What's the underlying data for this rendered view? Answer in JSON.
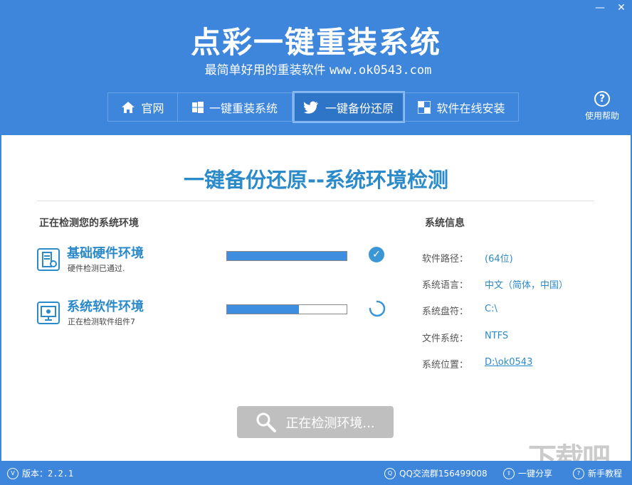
{
  "window": {
    "minimize": "—",
    "close": "✕"
  },
  "header": {
    "title": "点彩一键重装系统",
    "subtitle_text": "最简单好用的重装软件",
    "subtitle_url": "www.ok0543.com",
    "help_label": "使用帮助"
  },
  "nav": {
    "tabs": [
      {
        "label": "官网",
        "icon": "home-icon"
      },
      {
        "label": "一键重装系统",
        "icon": "windows-icon"
      },
      {
        "label": "一键备份还原",
        "icon": "bird-icon",
        "active": true
      },
      {
        "label": "软件在线安装",
        "icon": "grid-icon"
      }
    ]
  },
  "main": {
    "title": "一键备份还原--系统环境检测",
    "left_section": "正在检测您的系统环境",
    "right_section": "系统信息",
    "checks": [
      {
        "name": "基础硬件环境",
        "desc": "硬件检测已通过.",
        "progress": 1.0,
        "status": "done"
      },
      {
        "name": "系统软件环境",
        "desc": "正在检测软件组件7",
        "progress": 0.6,
        "status": "running"
      }
    ],
    "info": [
      {
        "key": "软件路径：",
        "value": "(64位)"
      },
      {
        "key": "系统语言：",
        "value": "中文（简体，中国）"
      },
      {
        "key": "系统盘符：",
        "value": "C:\\"
      },
      {
        "key": "文件系统：",
        "value": "NTFS"
      },
      {
        "key": "系统位置：",
        "value": "D:\\ok0543"
      }
    ],
    "button_label": "正在检测环境..."
  },
  "footer": {
    "version": "版本：2.2.1",
    "qq": "QQ交流群156499008",
    "share": "一键分享",
    "tutorial": "新手教程"
  },
  "watermark": "下载吧",
  "colors": {
    "primary": "#3d86dc",
    "accent": "#2b8ac9",
    "button_disabled": "#bfbfbf"
  }
}
